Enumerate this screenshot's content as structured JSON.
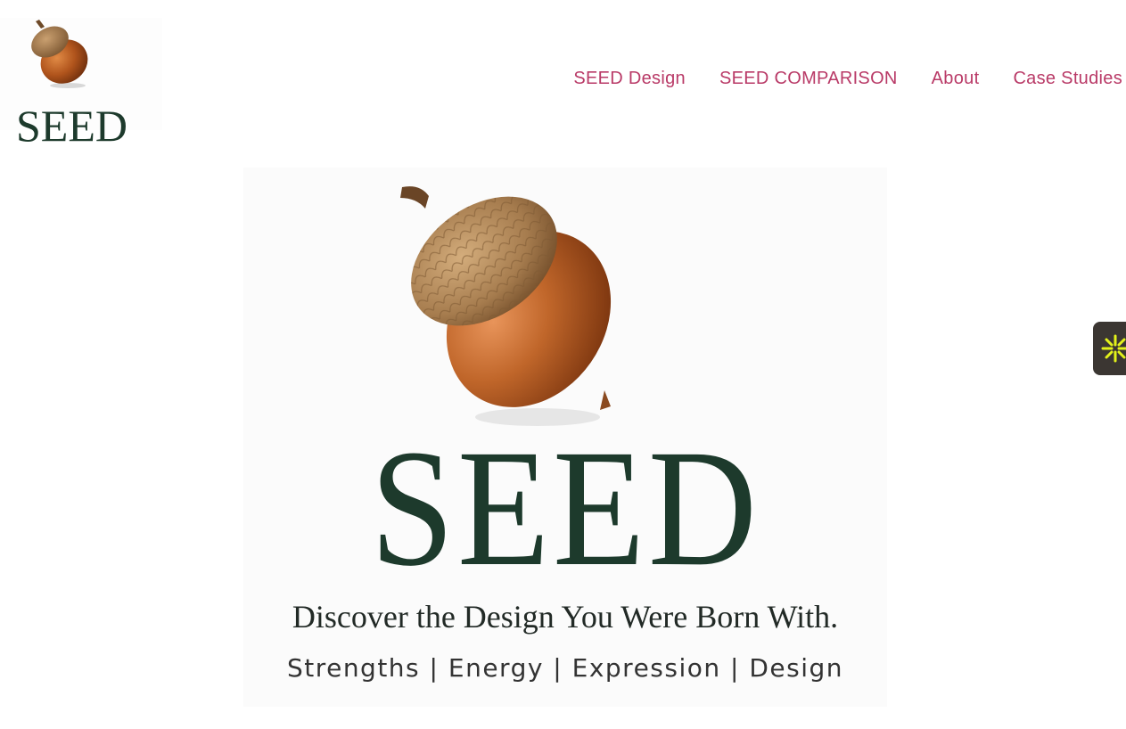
{
  "logo": {
    "text": "SEED",
    "icon": "acorn-icon"
  },
  "nav": {
    "items": [
      {
        "label": "SEED Design"
      },
      {
        "label": "SEED COMPARISON"
      },
      {
        "label": "About"
      },
      {
        "label": "Case Studies"
      }
    ]
  },
  "hero": {
    "title": "SEED",
    "tagline": "Discover the Design You Were Born With.",
    "pillars": "Strengths | Energy | Expression | Design",
    "icon": "acorn-icon"
  },
  "side_widget": {
    "icon": "asterisk-icon",
    "color": "#e3f21a"
  },
  "colors": {
    "nav_link": "#b93a67",
    "brand_green": "#1d3a2c",
    "acorn_body": "#b0541c",
    "acorn_cap": "#9c7448",
    "widget_bg": "#3b3632"
  }
}
